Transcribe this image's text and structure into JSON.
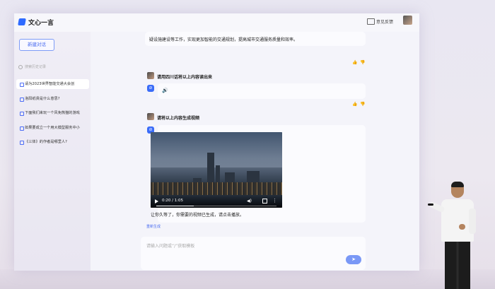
{
  "app": {
    "brand": "文心一言",
    "feedback_label": "意见反馈"
  },
  "sidebar": {
    "new_chat_label": "新建对话",
    "search_placeholder": "搜索历史记录",
    "history": [
      {
        "label": "请为2023世界智能交通大会创",
        "active": true
      },
      {
        "label": "洛阳纸贵是什么意思?",
        "active": false
      },
      {
        "label": "下面我们来玩一个风免熊猫的游戏",
        "active": false
      },
      {
        "label": "如果要成立一个用大模型服务中小",
        "active": false
      },
      {
        "label": "《三体》的作者是哪里人?",
        "active": false
      }
    ]
  },
  "conversation": {
    "partial_answer": "疑设施建设等工作，实现更加智能的交通规划，提高城市交通服务质量和效率。",
    "q1": "请用四川话将以上内容读出来",
    "q2": "请将以上内容生成视频",
    "video": {
      "time": "0:20 / 1:05",
      "progress": 0.31
    },
    "video_answer": "让你久等了，你需要的视频已生成，请点击播放。",
    "regenerate_label": "重新生成"
  },
  "input": {
    "placeholder": "请输入问题或“/”获取模板"
  },
  "colors": {
    "accent": "#3a6cf8",
    "send_button": "#7a98f6"
  }
}
